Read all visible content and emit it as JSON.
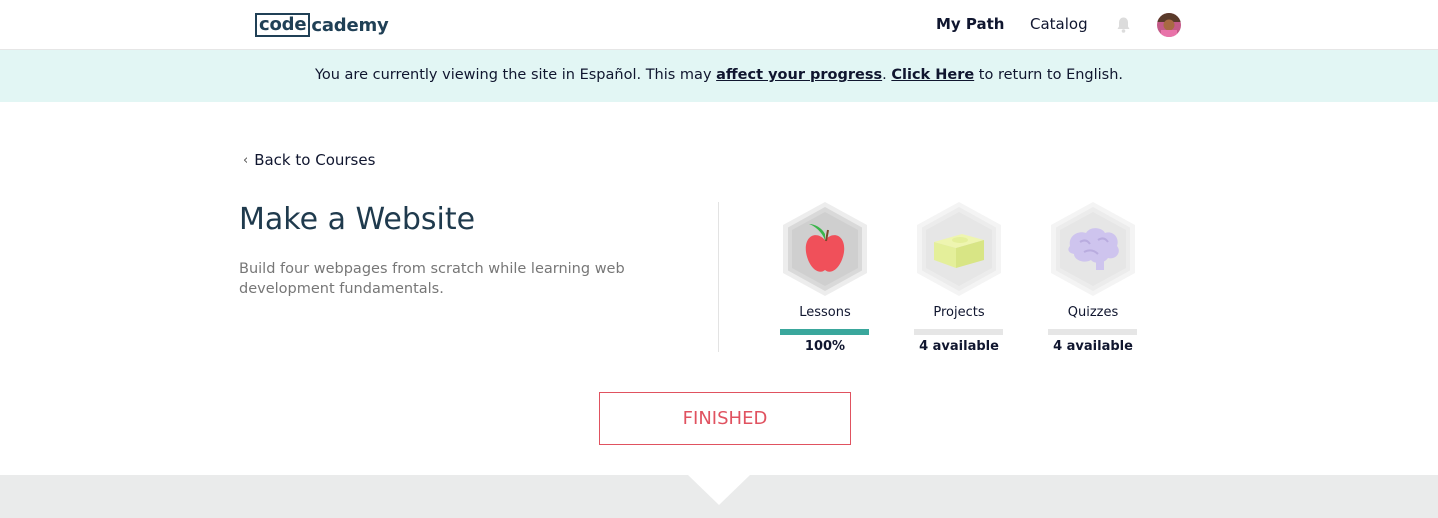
{
  "logo": {
    "box": "code",
    "rest": "cademy"
  },
  "nav": {
    "my_path": "My Path",
    "catalog": "Catalog",
    "bell_icon": "bell-icon",
    "avatar_icon": "avatar"
  },
  "banner": {
    "prefix": "You are currently viewing the site in Español. This may ",
    "link1": "affect your progress",
    "mid": ". ",
    "link2": "Click Here",
    "suffix": " to return to English."
  },
  "back": {
    "label": "Back to Courses",
    "icon": "chevron-left-icon"
  },
  "course": {
    "title": "Make a Website",
    "description": "Build four webpages from scratch while learning web development fundamentals."
  },
  "stats": [
    {
      "label": "Lessons",
      "value": "100%",
      "progress": 1.0,
      "icon": "apple-icon"
    },
    {
      "label": "Projects",
      "value": "4 available",
      "progress": 0,
      "icon": "block-icon"
    },
    {
      "label": "Quizzes",
      "value": "4 available",
      "progress": 0,
      "icon": "brain-icon"
    }
  ],
  "colors": {
    "accent": "#3aa79c",
    "finished": "#e05260",
    "banner_bg": "#e2f6f4"
  },
  "finished_label": "FINISHED"
}
